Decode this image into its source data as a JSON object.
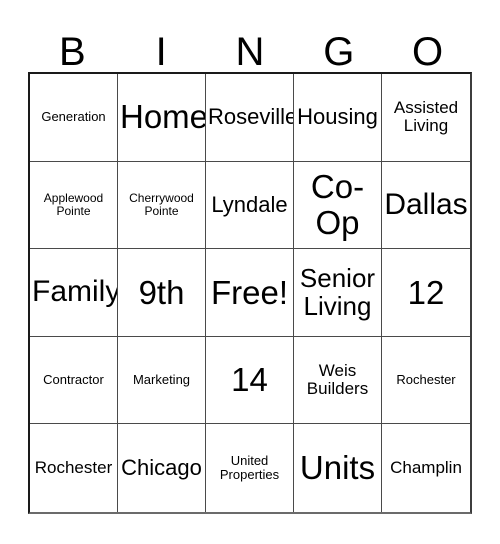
{
  "card": {
    "title": "BINGO",
    "header_letters": [
      "B",
      "I",
      "N",
      "G",
      "O"
    ],
    "free_space_label": "Free!",
    "colors": {
      "background": "#ffffff",
      "text": "#000000",
      "grid_line": "#4a4a4a",
      "outer_border": "#1a1a1a"
    },
    "columns": 5,
    "rows": 5,
    "cells": [
      {
        "text": "Generation",
        "size": "xs"
      },
      {
        "text": "Home",
        "size": "xxl"
      },
      {
        "text": "Roseville",
        "size": "md"
      },
      {
        "text": "Housing",
        "size": "md"
      },
      {
        "text": "Assisted\nLiving",
        "size": "sm"
      },
      {
        "text": "Applewood\nPointe",
        "size": "xxs"
      },
      {
        "text": "Cherrywood\nPointe",
        "size": "xxs"
      },
      {
        "text": "Lyndale",
        "size": "md"
      },
      {
        "text": "Co-\nOp",
        "size": "xxl"
      },
      {
        "text": "Dallas",
        "size": "xl"
      },
      {
        "text": "Family",
        "size": "xl"
      },
      {
        "text": "9th",
        "size": "xxl"
      },
      {
        "text": "Free!",
        "size": "xxl"
      },
      {
        "text": "Senior\nLiving",
        "size": "lg"
      },
      {
        "text": "12",
        "size": "xxl"
      },
      {
        "text": "Contractor",
        "size": "xs"
      },
      {
        "text": "Marketing",
        "size": "xs"
      },
      {
        "text": "14",
        "size": "xxl"
      },
      {
        "text": "Weis\nBuilders",
        "size": "sm"
      },
      {
        "text": "Rochester",
        "size": "xs"
      },
      {
        "text": "Rochester",
        "size": "sm"
      },
      {
        "text": "Chicago",
        "size": "md"
      },
      {
        "text": "United\nProperties",
        "size": "xs"
      },
      {
        "text": "Units",
        "size": "xxl"
      },
      {
        "text": "Champlin",
        "size": "sm"
      }
    ]
  }
}
